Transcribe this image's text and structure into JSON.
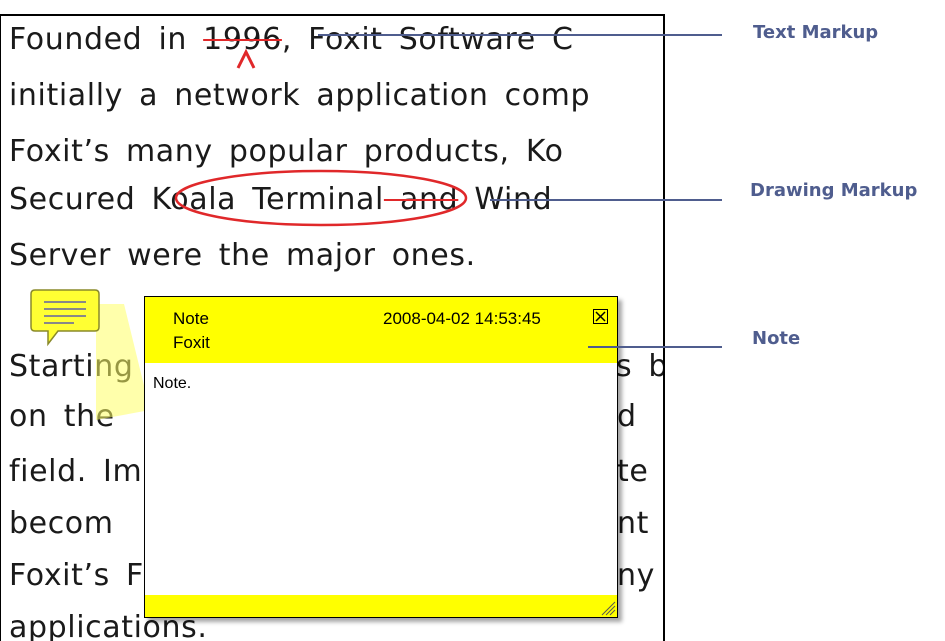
{
  "document": {
    "lines": [
      {
        "before": "Founded in ",
        "struck": "1996",
        "after": ", Foxit Software C"
      },
      {
        "text": "initially a network application comp"
      },
      {
        "text": "Foxit’s many popular products, Ko"
      },
      {
        "before": "Secured ",
        "circled": "Koala Terminal",
        "struck": " and",
        "after": " Wind"
      },
      {
        "text": "Server were the major ones."
      },
      {
        "text": "Starting"
      },
      {
        "text": "s b"
      },
      {
        "text": "on the"
      },
      {
        "text": "d"
      },
      {
        "text": "field. Im"
      },
      {
        "text": "te"
      },
      {
        "text": "becom"
      },
      {
        "text": "nt"
      },
      {
        "text": "Foxit’s F"
      },
      {
        "text": "ny"
      },
      {
        "text": "applications."
      }
    ]
  },
  "note": {
    "title": "Note",
    "author": "Foxit",
    "timestamp": "2008-04-02 14:53:45",
    "body": "Note."
  },
  "callouts": {
    "text_markup": "Text Markup",
    "drawing_markup": "Drawing Markup",
    "note": "Note"
  },
  "colors": {
    "markup_red": "#e0282a",
    "note_yellow": "#ffff00",
    "callout_blue": "#4f5d8e"
  },
  "icons": {
    "note_icon": "speech-bubble-note-icon",
    "caret_icon": "insert-caret-icon",
    "close_icon": "close-box-icon",
    "resize_icon": "resize-grip-icon"
  }
}
